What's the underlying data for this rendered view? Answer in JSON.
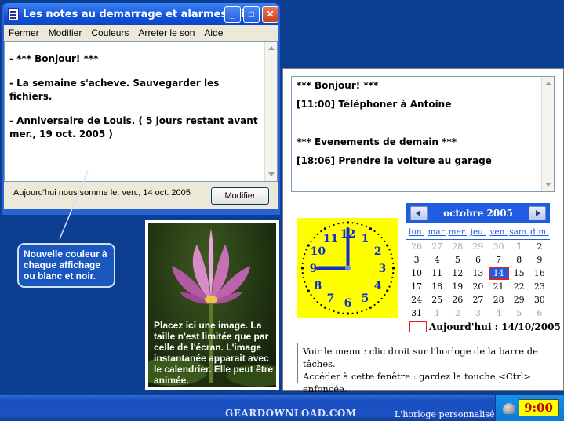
{
  "notes_window": {
    "title": "Les notes au demarrage et alarmes. Li...",
    "menu": [
      "Fermer",
      "Modifier",
      "Couleurs",
      "Arreter le son",
      "Aide"
    ],
    "lines": [
      "- *** Bonjour! ***",
      "- La semaine s'acheve. Sauvegarder les fichiers.",
      "- Anniversaire de Louis. ( 5 jours restant avant mer., 19 oct. 2005 )"
    ],
    "status": "Aujourd'hui nous somme le: ven., 14 oct. 2005",
    "modify_button": "Modifier"
  },
  "callout": "Nouvelle couleur à chaque affichage ou blanc et noir.",
  "image_caption": "Placez ici une image. La taille n'est limitée que par celle de l'écran. L'image instantanée apparait avec le calendrier. Elle peut être animée.",
  "top_notes": [
    "*** Bonjour! ***",
    "[11:00] Téléphoner à Antoine",
    "",
    "*** Evenements de demain ***",
    "[18:06] Prendre la voiture au garage"
  ],
  "clock_face": {
    "numbers": [
      "12",
      "1",
      "2",
      "3",
      "4",
      "5",
      "6",
      "7",
      "8",
      "9",
      "10",
      "11"
    ],
    "hour": 9,
    "minute": 0
  },
  "calendar": {
    "month_label": "octobre 2005",
    "weekdays": [
      "lun.",
      "mar.",
      "mer.",
      "jeu.",
      "ven.",
      "sam.",
      "dim."
    ],
    "weeks": [
      [
        "26",
        "27",
        "28",
        "29",
        "30",
        "1",
        "2"
      ],
      [
        "3",
        "4",
        "5",
        "6",
        "7",
        "8",
        "9"
      ],
      [
        "10",
        "11",
        "12",
        "13",
        "14",
        "15",
        "16"
      ],
      [
        "17",
        "18",
        "19",
        "20",
        "21",
        "22",
        "23"
      ],
      [
        "24",
        "25",
        "26",
        "27",
        "28",
        "29",
        "30"
      ],
      [
        "31",
        "1",
        "2",
        "3",
        "4",
        "5",
        "6"
      ]
    ],
    "other_month_flags": [
      [
        1,
        1,
        1,
        1,
        1,
        0,
        0
      ],
      [
        0,
        0,
        0,
        0,
        0,
        0,
        0
      ],
      [
        0,
        0,
        0,
        0,
        0,
        0,
        0
      ],
      [
        0,
        0,
        0,
        0,
        0,
        0,
        0
      ],
      [
        0,
        0,
        0,
        0,
        0,
        0,
        0
      ],
      [
        0,
        1,
        1,
        1,
        1,
        1,
        1
      ]
    ],
    "today": "14",
    "today_label": "Aujourd'hui : 14/10/2005"
  },
  "help_text": [
    "Voir le menu : clic droit sur l'horloge de la barre de tâches.",
    "Accéder à cette fenêtre : gardez la touche <Ctrl>",
    "enfoncée."
  ],
  "taskbar": {
    "watermark": "GEARDOWNLOAD.COM",
    "tooltip": "L'horloge personnalisé",
    "tray_time": "9:00"
  },
  "colors": {
    "accent": "#1f5ce0",
    "clock_face": "#ffff00",
    "today_outline": "#e02020",
    "desktop": "#0c3e92"
  }
}
